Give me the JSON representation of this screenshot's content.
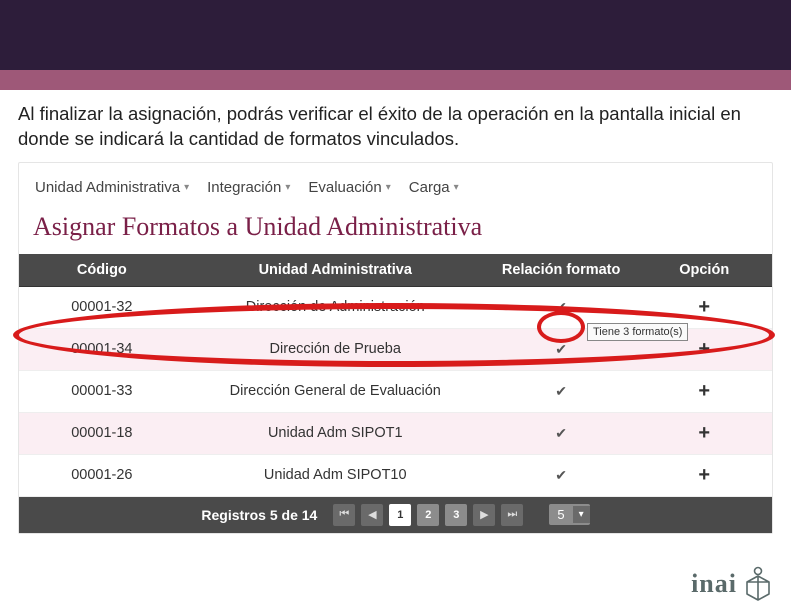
{
  "caption": "Al finalizar la asignación, podrás verificar el éxito de la operación en la pantalla inicial en donde se indicará la cantidad de formatos vinculados.",
  "menu": {
    "item0": "Unidad Administrativa",
    "item1": "Integración",
    "item2": "Evaluación",
    "item3": "Carga"
  },
  "page_title": "Asignar Formatos a Unidad Administrativa",
  "headers": {
    "codigo": "Código",
    "unidad": "Unidad Administrativa",
    "relacion": "Relación formato",
    "opcion": "Opción"
  },
  "rows": [
    {
      "codigo": "00001-32",
      "unidad": "Dirección de Administración"
    },
    {
      "codigo": "00001-34",
      "unidad": "Dirección de Prueba"
    },
    {
      "codigo": "00001-33",
      "unidad": "Dirección General de Evaluación"
    },
    {
      "codigo": "00001-18",
      "unidad": "Unidad Adm SIPOT1"
    },
    {
      "codigo": "00001-26",
      "unidad": "Unidad Adm SIPOT10"
    }
  ],
  "tooltip": "Tiene 3 formato(s)",
  "pager": {
    "label": "Registros 5 de 14",
    "p1": "1",
    "p2": "2",
    "p3": "3",
    "size": "5"
  },
  "logo": "inai"
}
